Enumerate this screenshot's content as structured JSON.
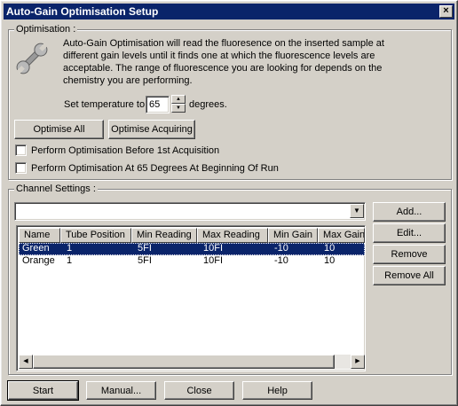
{
  "window": {
    "title": "Auto-Gain Optimisation Setup",
    "close_symbol": "×"
  },
  "optimisation": {
    "group_label": "Optimisation :",
    "description_lines": [
      "Auto-Gain Optimisation will read the fluoresence on the inserted sample at",
      "different gain levels until it finds one at which the fluorescence levels are",
      "acceptable. The range of fluorescence you are looking for depends on the",
      "chemistry you are performing."
    ],
    "icon": "wrench-icon",
    "temperature_label": "Set temperature to",
    "temperature_value": "65",
    "temperature_unit": "degrees.",
    "optimise_all_label": "Optimise All",
    "optimise_acquiring_label": "Optimise Acquiring",
    "checkbox_before_first": "Perform Optimisation Before 1st Acquisition",
    "checkbox_at_65": "Perform Optimisation At 65 Degrees At Beginning Of Run"
  },
  "channel_settings": {
    "group_label": "Channel Settings :",
    "combo_value": "",
    "columns": [
      "Name",
      "Tube Position",
      "Min Reading",
      "Max Reading",
      "Min Gain",
      "Max Gain"
    ],
    "rows": [
      [
        "Green",
        "1",
        "5FI",
        "10FI",
        "-10",
        "10"
      ],
      [
        "Orange",
        "1",
        "5FI",
        "10FI",
        "-10",
        "10"
      ]
    ],
    "add_label": "Add...",
    "edit_label": "Edit...",
    "remove_label": "Remove",
    "remove_all_label": "Remove All"
  },
  "footer": {
    "start_label": "Start",
    "manual_label": "Manual...",
    "close_label": "Close",
    "help_label": "Help"
  }
}
